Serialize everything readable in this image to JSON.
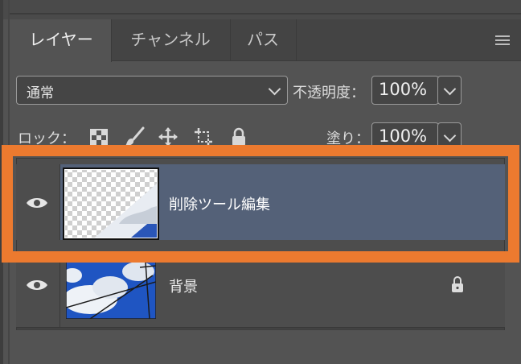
{
  "tabs": [
    {
      "label": "レイヤー",
      "active": true
    },
    {
      "label": "チャンネル",
      "active": false
    },
    {
      "label": "パス",
      "active": false
    }
  ],
  "panel_menu_icon": "hamburger-menu-icon",
  "blend_mode": {
    "value": "通常"
  },
  "opacity": {
    "label": "不透明度：",
    "value": "100%"
  },
  "lock": {
    "label": "ロック：",
    "icons": [
      "lock-transparent-pixels-icon",
      "lock-image-pixels-icon",
      "lock-position-icon",
      "lock-artboard-icon",
      "lock-all-icon"
    ]
  },
  "fill": {
    "label": "塗り：",
    "value": "100%"
  },
  "layers": [
    {
      "name": "削除ツール編集",
      "selected": true,
      "visible": true,
      "locked": false
    },
    {
      "name": "背景",
      "selected": false,
      "visible": true,
      "locked": true
    }
  ],
  "colors": {
    "highlight": "#ec7a2f",
    "selected_row": "#546178"
  }
}
